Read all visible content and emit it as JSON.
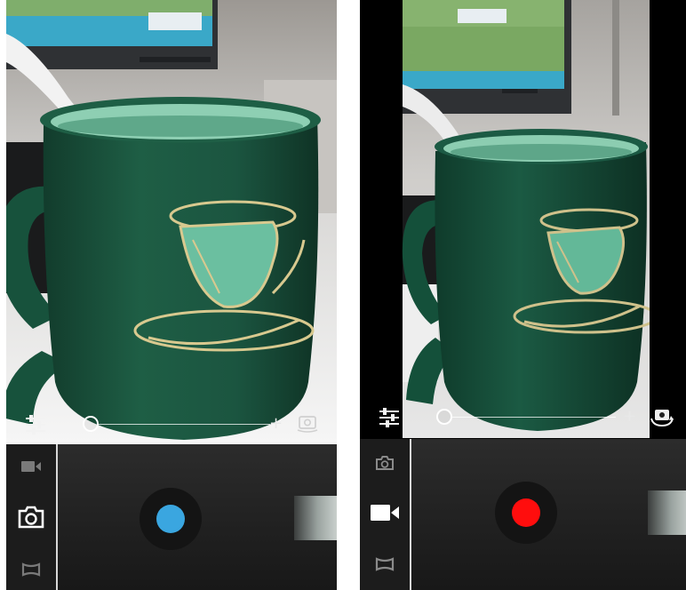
{
  "colors": {
    "photo_shutter": "#3aa6e0",
    "video_record": "#ff0d0d",
    "control_bar": "#202020",
    "mug_green": "#1d5a42",
    "mug_inner": "#8fcdb1",
    "decal_gold": "#d8c98f"
  },
  "screens": [
    {
      "mode": "photo",
      "icons": [
        "settings-sliders-icon",
        "zoom-slider",
        "zoom-in-plus",
        "switch-camera-icon",
        "video-mode-icon",
        "camera-mode-icon",
        "panorama-mode-icon",
        "shutter-button",
        "thumbnail"
      ],
      "zoom_plus": "+",
      "zoom_level": 0.0,
      "active_mode": "camera"
    },
    {
      "mode": "video",
      "icons": [
        "settings-sliders-icon",
        "zoom-slider",
        "zoom-in-plus",
        "switch-camera-icon",
        "camera-mode-icon",
        "video-mode-icon",
        "panorama-mode-icon",
        "record-button",
        "thumbnail"
      ],
      "zoom_plus": "+",
      "zoom_level": 0.0,
      "active_mode": "video"
    }
  ]
}
